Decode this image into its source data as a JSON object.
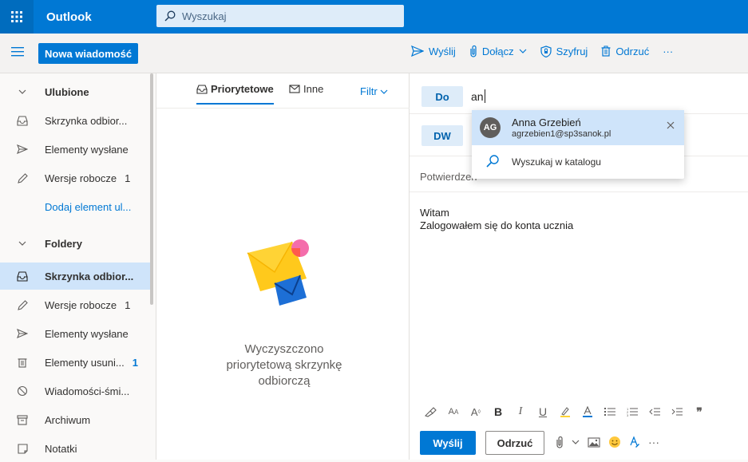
{
  "app": {
    "title": "Outlook",
    "accent": "#0078d4"
  },
  "search": {
    "placeholder": "Wyszukaj"
  },
  "toolbar": {
    "new_message": "Nowa wiadomość",
    "send": "Wyślij",
    "attach": "Dołącz",
    "encrypt": "Szyfruj",
    "discard": "Odrzuć",
    "more": "···"
  },
  "sidebar": {
    "favorites_header": "Ulubione",
    "favorites": [
      {
        "label": "Skrzynka odbior...",
        "count": "",
        "icon": "inbox-icon"
      },
      {
        "label": "Elementy wysłane",
        "count": "",
        "icon": "send-icon"
      },
      {
        "label": "Wersje robocze",
        "count": "1",
        "icon": "pencil-icon"
      }
    ],
    "add_favorite": "Dodaj element ul...",
    "folders_header": "Foldery",
    "folders": [
      {
        "label": "Skrzynka odbior...",
        "count": "",
        "icon": "inbox-icon",
        "selected": true
      },
      {
        "label": "Wersje robocze",
        "count": "1",
        "icon": "pencil-icon"
      },
      {
        "label": "Elementy wysłane",
        "count": "",
        "icon": "send-icon"
      },
      {
        "label": "Elementy usuni...",
        "count": "1",
        "icon": "trash-icon"
      },
      {
        "label": "Wiadomości-śmi...",
        "count": "",
        "icon": "block-icon"
      },
      {
        "label": "Archiwum",
        "count": "",
        "icon": "archive-icon"
      },
      {
        "label": "Notatki",
        "count": "",
        "icon": "note-icon"
      }
    ]
  },
  "message_list": {
    "tab_focused": "Priorytetowe",
    "tab_other": "Inne",
    "filter": "Filtr",
    "empty_message": "Wyczyszczono priorytetową skrzynkę odbiorczą"
  },
  "compose": {
    "to_label": "Do",
    "to_value": "an",
    "cc_label": "DW",
    "subject_partial": "Potwierdzen",
    "body_line1": "Witam",
    "body_line2": "Zalogowałem się do konta ucznia",
    "send_button": "Wyślij",
    "discard_button": "Odrzuć"
  },
  "suggestions": {
    "contact_initials": "AG",
    "contact_name": "Anna Grzebień",
    "contact_email": "agrzebien1@sp3sanok.pl",
    "search_directory": "Wyszukaj w katalogu"
  }
}
